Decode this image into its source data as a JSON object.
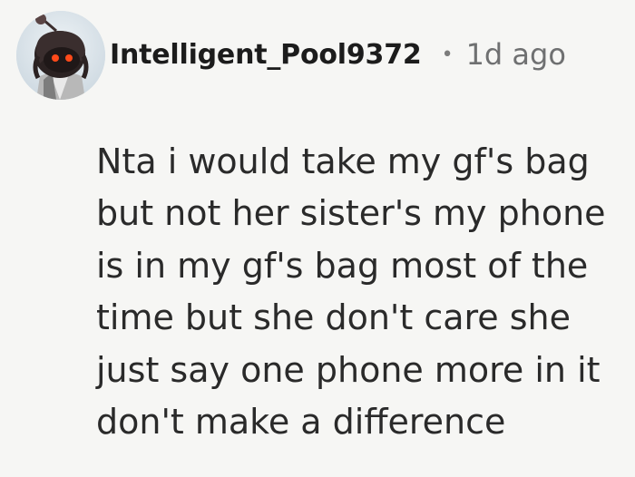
{
  "comment": {
    "author": "Intelligent_Pool9372",
    "separator": "•",
    "timestamp": "1d ago",
    "text": "Nta i would take my gf's bag but not her sister's my phone is in my gf's bag most of the time but she don't care she just say one phone more in it don't make a difference",
    "avatar_icon": "user-avatar-icon"
  }
}
